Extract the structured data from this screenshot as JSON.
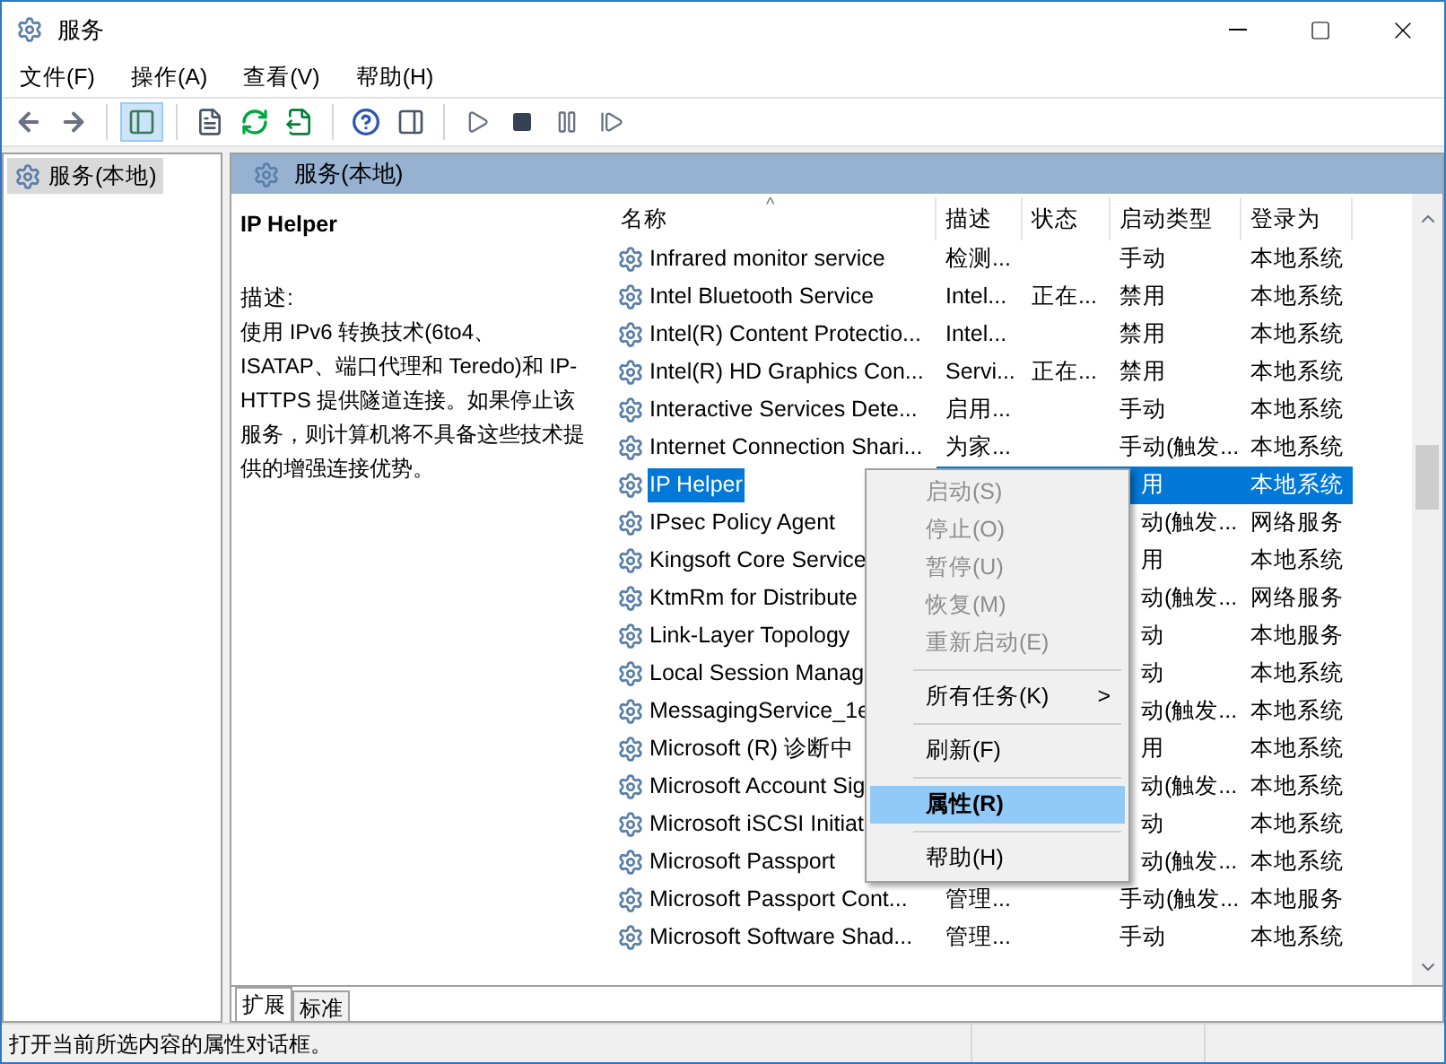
{
  "window": {
    "title": "服务"
  },
  "menu_bar": [
    "文件(F)",
    "操作(A)",
    "查看(V)",
    "帮助(H)"
  ],
  "tree": {
    "items": [
      {
        "label": "服务(本地)",
        "selected": true
      }
    ]
  },
  "panel_header": "服务(本地)",
  "details": {
    "title": "IP Helper",
    "description_label": "描述:",
    "description": "使用 IPv6 转换技术(6to4、ISATAP、端口代理和 Teredo)和 IP-HTTPS 提供隧道连接。如果停止该服务，则计算机将不具备这些技术提供的增强连接优势。"
  },
  "table": {
    "sort_indicator": "^",
    "columns": [
      "名称",
      "描述",
      "状态",
      "启动类型",
      "登录为"
    ],
    "rows": [
      {
        "kind": "full",
        "selected": false,
        "cells": [
          "Infrared monitor service",
          "检测...",
          "",
          "手动",
          "本地系统"
        ]
      },
      {
        "kind": "full",
        "selected": false,
        "cells": [
          "Intel Bluetooth Service",
          "Intel...",
          "正在...",
          "禁用",
          "本地系统"
        ]
      },
      {
        "kind": "full",
        "selected": false,
        "cells": [
          "Intel(R) Content Protectio...",
          "Intel...",
          "",
          "禁用",
          "本地系统"
        ]
      },
      {
        "kind": "full",
        "selected": false,
        "cells": [
          "Intel(R) HD Graphics Con...",
          "Servi...",
          "正在...",
          "禁用",
          "本地系统"
        ]
      },
      {
        "kind": "full",
        "selected": false,
        "cells": [
          "Interactive Services Dete...",
          "启用...",
          "",
          "手动",
          "本地系统"
        ]
      },
      {
        "kind": "full",
        "selected": false,
        "cells": [
          "Internet Connection Shari...",
          "为家...",
          "",
          "手动(触发...",
          "本地系统"
        ]
      },
      {
        "kind": "covered",
        "selected": true,
        "cells": [
          "IP Helper",
          "用",
          "本地系统"
        ]
      },
      {
        "kind": "covered",
        "selected": false,
        "cells": [
          "IPsec Policy Agent",
          "动(触发...",
          "网络服务"
        ]
      },
      {
        "kind": "covered",
        "selected": false,
        "cells": [
          "Kingsoft Core Service",
          "用",
          "本地系统"
        ]
      },
      {
        "kind": "covered",
        "selected": false,
        "cells": [
          "KtmRm for Distribute",
          "动(触发...",
          "网络服务"
        ]
      },
      {
        "kind": "covered",
        "selected": false,
        "cells": [
          "Link-Layer Topology",
          "动",
          "本地服务"
        ]
      },
      {
        "kind": "covered",
        "selected": false,
        "cells": [
          "Local Session Manag",
          "动",
          "本地系统"
        ]
      },
      {
        "kind": "covered",
        "selected": false,
        "cells": [
          "MessagingService_1e",
          "动(触发...",
          "本地系统"
        ]
      },
      {
        "kind": "covered",
        "selected": false,
        "cells": [
          "Microsoft (R) 诊断中",
          "用",
          "本地系统"
        ]
      },
      {
        "kind": "covered",
        "selected": false,
        "cells": [
          "Microsoft Account Sig",
          "动(触发...",
          "本地系统"
        ]
      },
      {
        "kind": "covered",
        "selected": false,
        "cells": [
          "Microsoft iSCSI Initiat",
          "动",
          "本地系统"
        ]
      },
      {
        "kind": "covered",
        "selected": false,
        "cells": [
          "Microsoft Passport",
          "动(触发...",
          "本地系统"
        ]
      },
      {
        "kind": "full",
        "selected": false,
        "cells": [
          "Microsoft Passport Cont...",
          "管理...",
          "",
          "手动(触发...",
          "本地服务"
        ]
      },
      {
        "kind": "full",
        "selected": false,
        "cells": [
          "Microsoft Software Shad...",
          "管理...",
          "",
          "手动",
          "本地系统"
        ]
      }
    ]
  },
  "context_menu": [
    {
      "kind": "item",
      "label": "启动(S)",
      "disabled": true,
      "selected": false
    },
    {
      "kind": "item",
      "label": "停止(O)",
      "disabled": true,
      "selected": false
    },
    {
      "kind": "item",
      "label": "暂停(U)",
      "disabled": true,
      "selected": false
    },
    {
      "kind": "item",
      "label": "恢复(M)",
      "disabled": true,
      "selected": false
    },
    {
      "kind": "item",
      "label": "重新启动(E)",
      "disabled": true,
      "selected": false
    },
    {
      "kind": "separator"
    },
    {
      "kind": "submenu",
      "label": "所有任务(K)",
      "arrow": ">",
      "disabled": false,
      "selected": false
    },
    {
      "kind": "separator"
    },
    {
      "kind": "item",
      "label": "刷新(F)",
      "disabled": false,
      "selected": false
    },
    {
      "kind": "separator"
    },
    {
      "kind": "item",
      "label": "属性(R)",
      "disabled": false,
      "selected": true
    },
    {
      "kind": "separator"
    },
    {
      "kind": "item",
      "label": "帮助(H)",
      "disabled": false,
      "selected": false
    }
  ],
  "tabs": [
    {
      "label": "扩展",
      "selected": true
    },
    {
      "label": "标准",
      "selected": false
    }
  ],
  "status_bar": "打开当前所选内容的属性对话框。"
}
